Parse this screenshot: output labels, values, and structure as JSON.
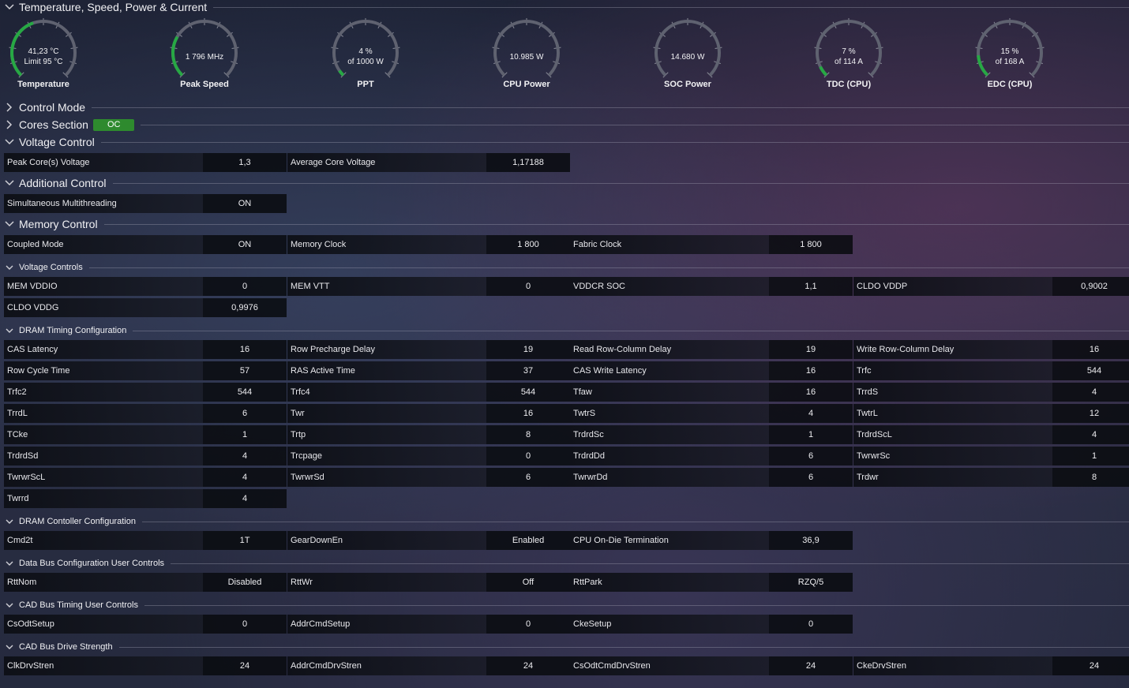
{
  "colors": {
    "gauge_track": "#5f6270",
    "gauge_fill": "#27a844",
    "oc_badge": "#2e8a2e"
  },
  "sections": {
    "temp": "Temperature, Speed, Power & Current",
    "control_mode": "Control Mode",
    "cores": "Cores Section",
    "cores_badge": "OC",
    "voltage_control": "Voltage Control",
    "additional_control": "Additional Control",
    "memory_control": "Memory Control",
    "voltage_controls": "Voltage Controls",
    "dram_timing": "DRAM Timing Configuration",
    "dram_controller": "DRAM Contoller Configuration",
    "data_bus": "Data Bus Configuration User Controls",
    "cad_timing": "CAD Bus Timing User Controls",
    "cad_drive": "CAD Bus Drive Strength"
  },
  "gauges": [
    {
      "name": "Temperature",
      "line1": "41,23 °C",
      "line2": "Limit 95 °C",
      "fill": 0.43
    },
    {
      "name": "Peak Speed",
      "line1": "1 796  MHz",
      "line2": "",
      "fill": 0.28
    },
    {
      "name": "PPT",
      "line1": "4 %",
      "line2": "of 1000 W",
      "fill": 0.04
    },
    {
      "name": "CPU Power",
      "line1": "10.985 W",
      "line2": "",
      "fill": 0.0
    },
    {
      "name": "SOC Power",
      "line1": "14.680 W",
      "line2": "",
      "fill": 0.0
    },
    {
      "name": "TDC (CPU)",
      "line1": "7 %",
      "line2": "of 114 A",
      "fill": 0.07
    },
    {
      "name": "EDC (CPU)",
      "line1": "15 %",
      "line2": "of 168 A",
      "fill": 0.15
    }
  ],
  "voltage_control": [
    {
      "label": "Peak Core(s) Voltage",
      "value": "1,3"
    },
    {
      "label": "Average Core Voltage",
      "value": "1,17188"
    }
  ],
  "additional_control": [
    {
      "label": "Simultaneous Multithreading",
      "value": "ON"
    }
  ],
  "memory_control": [
    {
      "label": "Coupled Mode",
      "value": "ON"
    },
    {
      "label": "Memory Clock",
      "value": "1 800"
    },
    {
      "label": "Fabric Clock",
      "value": "1 800"
    }
  ],
  "voltage_controls": [
    {
      "label": "MEM VDDIO",
      "value": "0"
    },
    {
      "label": "MEM VTT",
      "value": "0"
    },
    {
      "label": "VDDCR SOC",
      "value": "1,1"
    },
    {
      "label": "CLDO VDDP",
      "value": "0,9002"
    },
    {
      "label": "CLDO VDDG",
      "value": "0,9976"
    }
  ],
  "dram_timing": [
    {
      "label": "CAS Latency",
      "value": "16"
    },
    {
      "label": "Row Precharge Delay",
      "value": "19"
    },
    {
      "label": "Read Row-Column Delay",
      "value": "19"
    },
    {
      "label": "Write Row-Column Delay",
      "value": "16"
    },
    {
      "label": "Row Cycle Time",
      "value": "57"
    },
    {
      "label": "RAS Active Time",
      "value": "37"
    },
    {
      "label": "CAS Write Latency",
      "value": "16"
    },
    {
      "label": "Trfc",
      "value": "544"
    },
    {
      "label": "Trfc2",
      "value": "544"
    },
    {
      "label": "Trfc4",
      "value": "544"
    },
    {
      "label": "Tfaw",
      "value": "16"
    },
    {
      "label": "TrrdS",
      "value": "4"
    },
    {
      "label": "TrrdL",
      "value": "6"
    },
    {
      "label": "Twr",
      "value": "16"
    },
    {
      "label": "TwtrS",
      "value": "4"
    },
    {
      "label": "TwtrL",
      "value": "12"
    },
    {
      "label": "TCke",
      "value": "1"
    },
    {
      "label": "Trtp",
      "value": "8"
    },
    {
      "label": "TrdrdSc",
      "value": "1"
    },
    {
      "label": "TrdrdScL",
      "value": "4"
    },
    {
      "label": "TrdrdSd",
      "value": "4"
    },
    {
      "label": "Trcpage",
      "value": "0"
    },
    {
      "label": "TrdrdDd",
      "value": "6"
    },
    {
      "label": "TwrwrSc",
      "value": "1"
    },
    {
      "label": "TwrwrScL",
      "value": "4"
    },
    {
      "label": "TwrwrSd",
      "value": "6"
    },
    {
      "label": "TwrwrDd",
      "value": "6"
    },
    {
      "label": "Trdwr",
      "value": "8"
    },
    {
      "label": "Twrrd",
      "value": "4"
    }
  ],
  "dram_controller": [
    {
      "label": "Cmd2t",
      "value": "1T"
    },
    {
      "label": "GearDownEn",
      "value": "Enabled"
    },
    {
      "label": "CPU On-Die Termination",
      "value": "36,9"
    }
  ],
  "data_bus": [
    {
      "label": "RttNom",
      "value": "Disabled"
    },
    {
      "label": "RttWr",
      "value": "Off"
    },
    {
      "label": "RttPark",
      "value": "RZQ/5"
    }
  ],
  "cad_timing": [
    {
      "label": "CsOdtSetup",
      "value": "0"
    },
    {
      "label": "AddrCmdSetup",
      "value": "0"
    },
    {
      "label": "CkeSetup",
      "value": "0"
    }
  ],
  "cad_drive": [
    {
      "label": "ClkDrvStren",
      "value": "24"
    },
    {
      "label": "AddrCmdDrvStren",
      "value": "24"
    },
    {
      "label": "CsOdtCmdDrvStren",
      "value": "24"
    },
    {
      "label": "CkeDrvStren",
      "value": "24"
    }
  ]
}
